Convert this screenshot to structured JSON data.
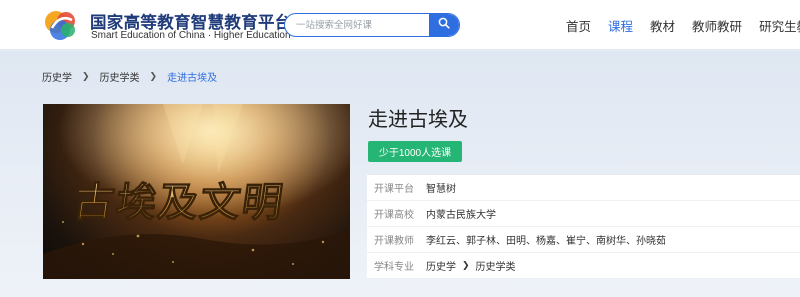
{
  "header": {
    "logo": {
      "title_cn": "国家高等教育智慧教育平台",
      "title_en": "Smart Education of China · Higher Education",
      "mark_text": "智慧教育",
      "icon": "platform-logo-icon"
    },
    "search": {
      "placeholder": "一站搜索全网好课",
      "button_icon": "search-icon"
    },
    "nav": [
      {
        "label": "首页",
        "active": false
      },
      {
        "label": "课程",
        "active": true
      },
      {
        "label": "教材",
        "active": false
      },
      {
        "label": "教师教研",
        "active": false
      },
      {
        "label": "研究生教育",
        "active": false
      }
    ]
  },
  "breadcrumb": [
    "历史学",
    "历史学类",
    "走进古埃及"
  ],
  "course": {
    "image_text": "古埃及文明",
    "title": "走进古埃及",
    "enroll_badge": "少于1000人选课",
    "info": {
      "platform_label": "开课平台",
      "platform_value": "智慧树",
      "school_label": "开课高校",
      "school_value": "内蒙古民族大学",
      "teachers_label": "开课教师",
      "teachers_value": "李红云、郭子林、田明、杨嘉、崔宁、南树华、孙晓茹",
      "subject_label": "学科专业",
      "subject_values": [
        "历史学",
        "历史学类"
      ]
    }
  },
  "colors": {
    "accent": "#2e6ee0",
    "badge": "#25b574",
    "brand_text": "#1f3b7a"
  }
}
